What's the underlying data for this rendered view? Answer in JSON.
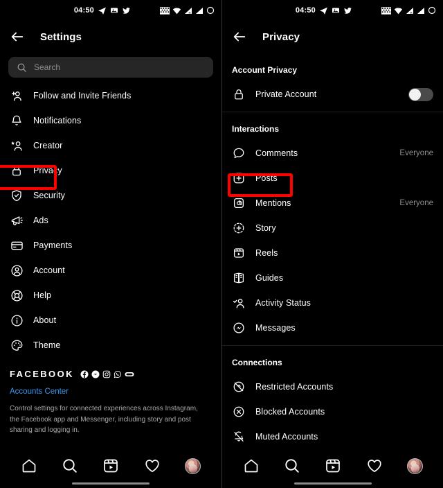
{
  "status_bar": {
    "time": "04:50",
    "left_icons": [
      "telegram-icon",
      "screenshot-icon",
      "twitter-icon"
    ],
    "right_icons": [
      "wifi-calling-icon",
      "wifi-icon",
      "signal-roaming-icon",
      "signal-icon",
      "battery-ring-icon"
    ]
  },
  "left_screen": {
    "header": {
      "back": "back-arrow",
      "title": "Settings"
    },
    "search": {
      "placeholder": "Search",
      "value": ""
    },
    "items": [
      {
        "label": "Follow and Invite Friends",
        "icon": "person-add-icon"
      },
      {
        "label": "Notifications",
        "icon": "bell-icon"
      },
      {
        "label": "Creator",
        "icon": "person-star-icon"
      },
      {
        "label": "Privacy",
        "icon": "lock-icon",
        "highlighted": true
      },
      {
        "label": "Security",
        "icon": "shield-check-icon"
      },
      {
        "label": "Ads",
        "icon": "megaphone-icon"
      },
      {
        "label": "Payments",
        "icon": "credit-card-icon"
      },
      {
        "label": "Account",
        "icon": "person-circle-icon"
      },
      {
        "label": "Help",
        "icon": "lifebuoy-icon"
      },
      {
        "label": "About",
        "icon": "info-circle-icon"
      },
      {
        "label": "Theme",
        "icon": "palette-icon"
      }
    ],
    "facebook": {
      "wordmark": "FACEBOOK",
      "icons": [
        "facebook-icon",
        "messenger-icon",
        "instagram-icon",
        "whatsapp-icon",
        "portal-icon"
      ],
      "link": "Accounts Center",
      "description": "Control settings for connected experiences across Instagram, the Facebook app and Messenger, including story and post sharing and logging in."
    }
  },
  "right_screen": {
    "header": {
      "back": "back-arrow",
      "title": "Privacy"
    },
    "sections": [
      {
        "title": "Account Privacy",
        "items": [
          {
            "label": "Private Account",
            "icon": "lock-icon",
            "toggle": true,
            "toggle_on": false
          }
        ]
      },
      {
        "title": "Interactions",
        "items": [
          {
            "label": "Comments",
            "icon": "comment-icon",
            "value": "Everyone"
          },
          {
            "label": "Posts",
            "icon": "plus-square-icon",
            "highlighted": true
          },
          {
            "label": "Mentions",
            "icon": "mention-icon",
            "value": "Everyone"
          },
          {
            "label": "Story",
            "icon": "story-icon"
          },
          {
            "label": "Reels",
            "icon": "reels-icon"
          },
          {
            "label": "Guides",
            "icon": "guides-icon"
          },
          {
            "label": "Activity Status",
            "icon": "person-check-icon"
          },
          {
            "label": "Messages",
            "icon": "messenger-icon"
          }
        ]
      },
      {
        "title": "Connections",
        "items": [
          {
            "label": "Restricted Accounts",
            "icon": "restricted-icon"
          },
          {
            "label": "Blocked Accounts",
            "icon": "blocked-icon"
          },
          {
            "label": "Muted Accounts",
            "icon": "muted-bell-icon"
          }
        ]
      }
    ]
  },
  "bottom_nav": {
    "items": [
      "home-icon",
      "search-icon",
      "reels-icon",
      "heart-icon",
      "profile-avatar"
    ]
  },
  "colors": {
    "highlight": "#ff0000",
    "link": "#3797f0",
    "muted": "#8e8e8e",
    "background": "#000000"
  }
}
